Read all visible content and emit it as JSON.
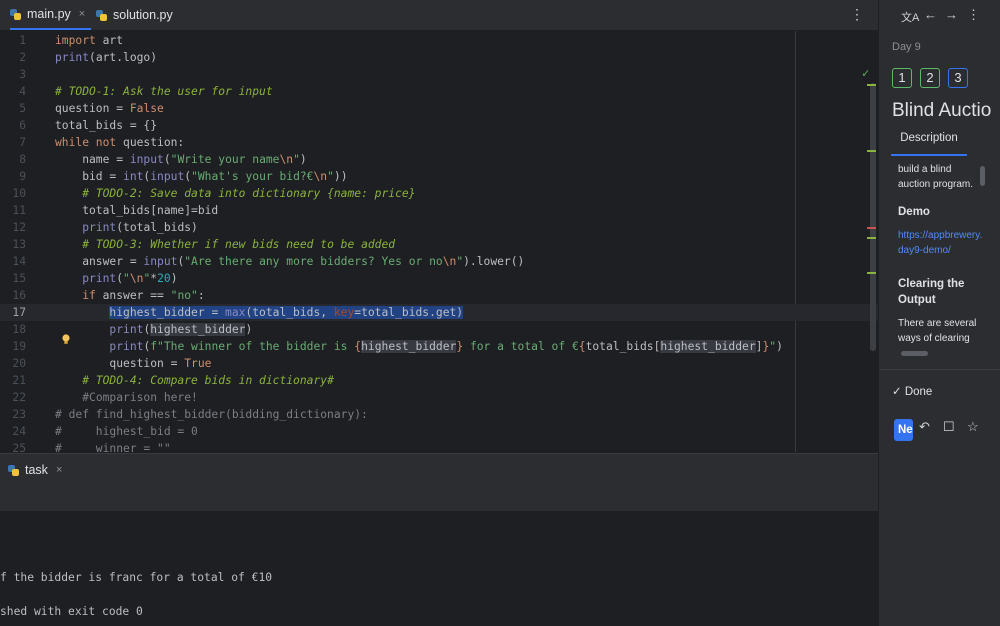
{
  "editor_tabs": [
    {
      "label": "main.py",
      "close": "×"
    },
    {
      "label": "solution.py"
    }
  ],
  "editor_menu": "⋮",
  "code_lines": [
    {
      "n": "1",
      "html": "<span class='kw'>import</span> art"
    },
    {
      "n": "2",
      "html": "<span class='bi'>print</span>(art.logo)"
    },
    {
      "n": "3",
      "html": ""
    },
    {
      "n": "4",
      "html": "<span class='todo'># TODO-1: Ask the user for input</span>"
    },
    {
      "n": "5",
      "html": "question = <span class='kw'>False</span>"
    },
    {
      "n": "6",
      "html": "total_bids = {}"
    },
    {
      "n": "7",
      "html": "<span class='kw'>while not</span> question:"
    },
    {
      "n": "8",
      "html": "    name = <span class='bi'>input</span>(<span class='str'>\"Write your name</span><span class='esc'>\\n</span><span class='str'>\"</span>)"
    },
    {
      "n": "9",
      "html": "    bid = <span class='bi'>int</span>(<span class='bi'>input</span>(<span class='str'>\"What's your bid?€</span><span class='esc'>\\n</span><span class='str'>\"</span>))"
    },
    {
      "n": "10",
      "html": "    <span class='todo'># TODO-2: Save data into dictionary {name: price}</span>"
    },
    {
      "n": "11",
      "html": "    total_bids[name]=bid"
    },
    {
      "n": "12",
      "html": "    <span class='bi'>print</span>(total_bids)"
    },
    {
      "n": "13",
      "html": "    <span class='todo'># TODO-3: Whether if new bids need to be added</span>"
    },
    {
      "n": "14",
      "html": "    answer = <span class='bi'>input</span>(<span class='str'>\"Are there any more bidders? Yes or no</span><span class='esc'>\\n</span><span class='str'>\"</span>).lower()"
    },
    {
      "n": "15",
      "html": "    <span class='bi'>print</span>(<span class='str'>\"</span><span class='esc'>\\n</span><span class='str'>\"</span>*<span class='num'>20</span>)"
    },
    {
      "n": "16",
      "html": "    <span class='kw'>if</span> answer == <span class='str'>\"no\"</span>:"
    },
    {
      "n": "17",
      "html": "        <span class='sel'>highest_bidder = <span class='bi'>max</span>(total_bids, <span class='param'>key</span>=total_bids.get)</span>"
    },
    {
      "n": "18",
      "html": "        <span class='bi'>print</span>(<span class='hl'>highest_bidder</span>)"
    },
    {
      "n": "19",
      "html": "        <span class='bi'>print</span>(<span class='str'>f\"The winner of the bidder is </span><span class='esc'>{</span><span class='hl'>highest_bidder</span><span class='esc'>}</span><span class='str'> for a total of €</span><span class='esc'>{</span>total_bids[<span class='hl'>highest_bidder</span>]<span class='esc'>}</span><span class='str'>\"</span>)"
    },
    {
      "n": "20",
      "html": "        question = <span class='kw'>True</span>"
    },
    {
      "n": "21",
      "html": "    <span class='todo'># TODO-4: Compare bids in dictionary#</span>"
    },
    {
      "n": "22",
      "html": "    <span class='cmt'>#Comparison here!</span>"
    },
    {
      "n": "23",
      "html": "<span class='cmt'># def find_highest_bidder(bidding_dictionary):</span>"
    },
    {
      "n": "24",
      "html": "<span class='cmt'>#     highest_bid = 0</span>"
    },
    {
      "n": "25",
      "html": "<span class='cmt'>#     winner = \"\"</span>"
    }
  ],
  "current_line": "17",
  "bottom_tab": {
    "label": "task",
    "close": "×"
  },
  "console_lines": [
    "f the bidder is franc for a total of €10",
    "shed with exit code 0"
  ],
  "panel": {
    "icons": [
      "translate-icon",
      "arrow-left-icon",
      "arrow-right-icon",
      "more-icon"
    ],
    "icon_glyphs": [
      "文A",
      "←",
      "→",
      "⋮"
    ],
    "day": "Day 9",
    "steps": [
      "1",
      "2",
      "3"
    ],
    "title": "Blind Auctio",
    "tab": "Description",
    "intro": "build a blind auction program.",
    "demo_heading": "Demo",
    "demo_link": "https://appbrewery.day9-demo/",
    "clearing_heading": "Clearing the Output",
    "clearing_text": "There are several ways of clearing",
    "done": "✓ Done",
    "next": "Next",
    "action_glyphs": [
      "↶",
      "☐",
      "☆"
    ]
  },
  "colors": {
    "accent": "#3574f0",
    "success": "#5fb865"
  }
}
